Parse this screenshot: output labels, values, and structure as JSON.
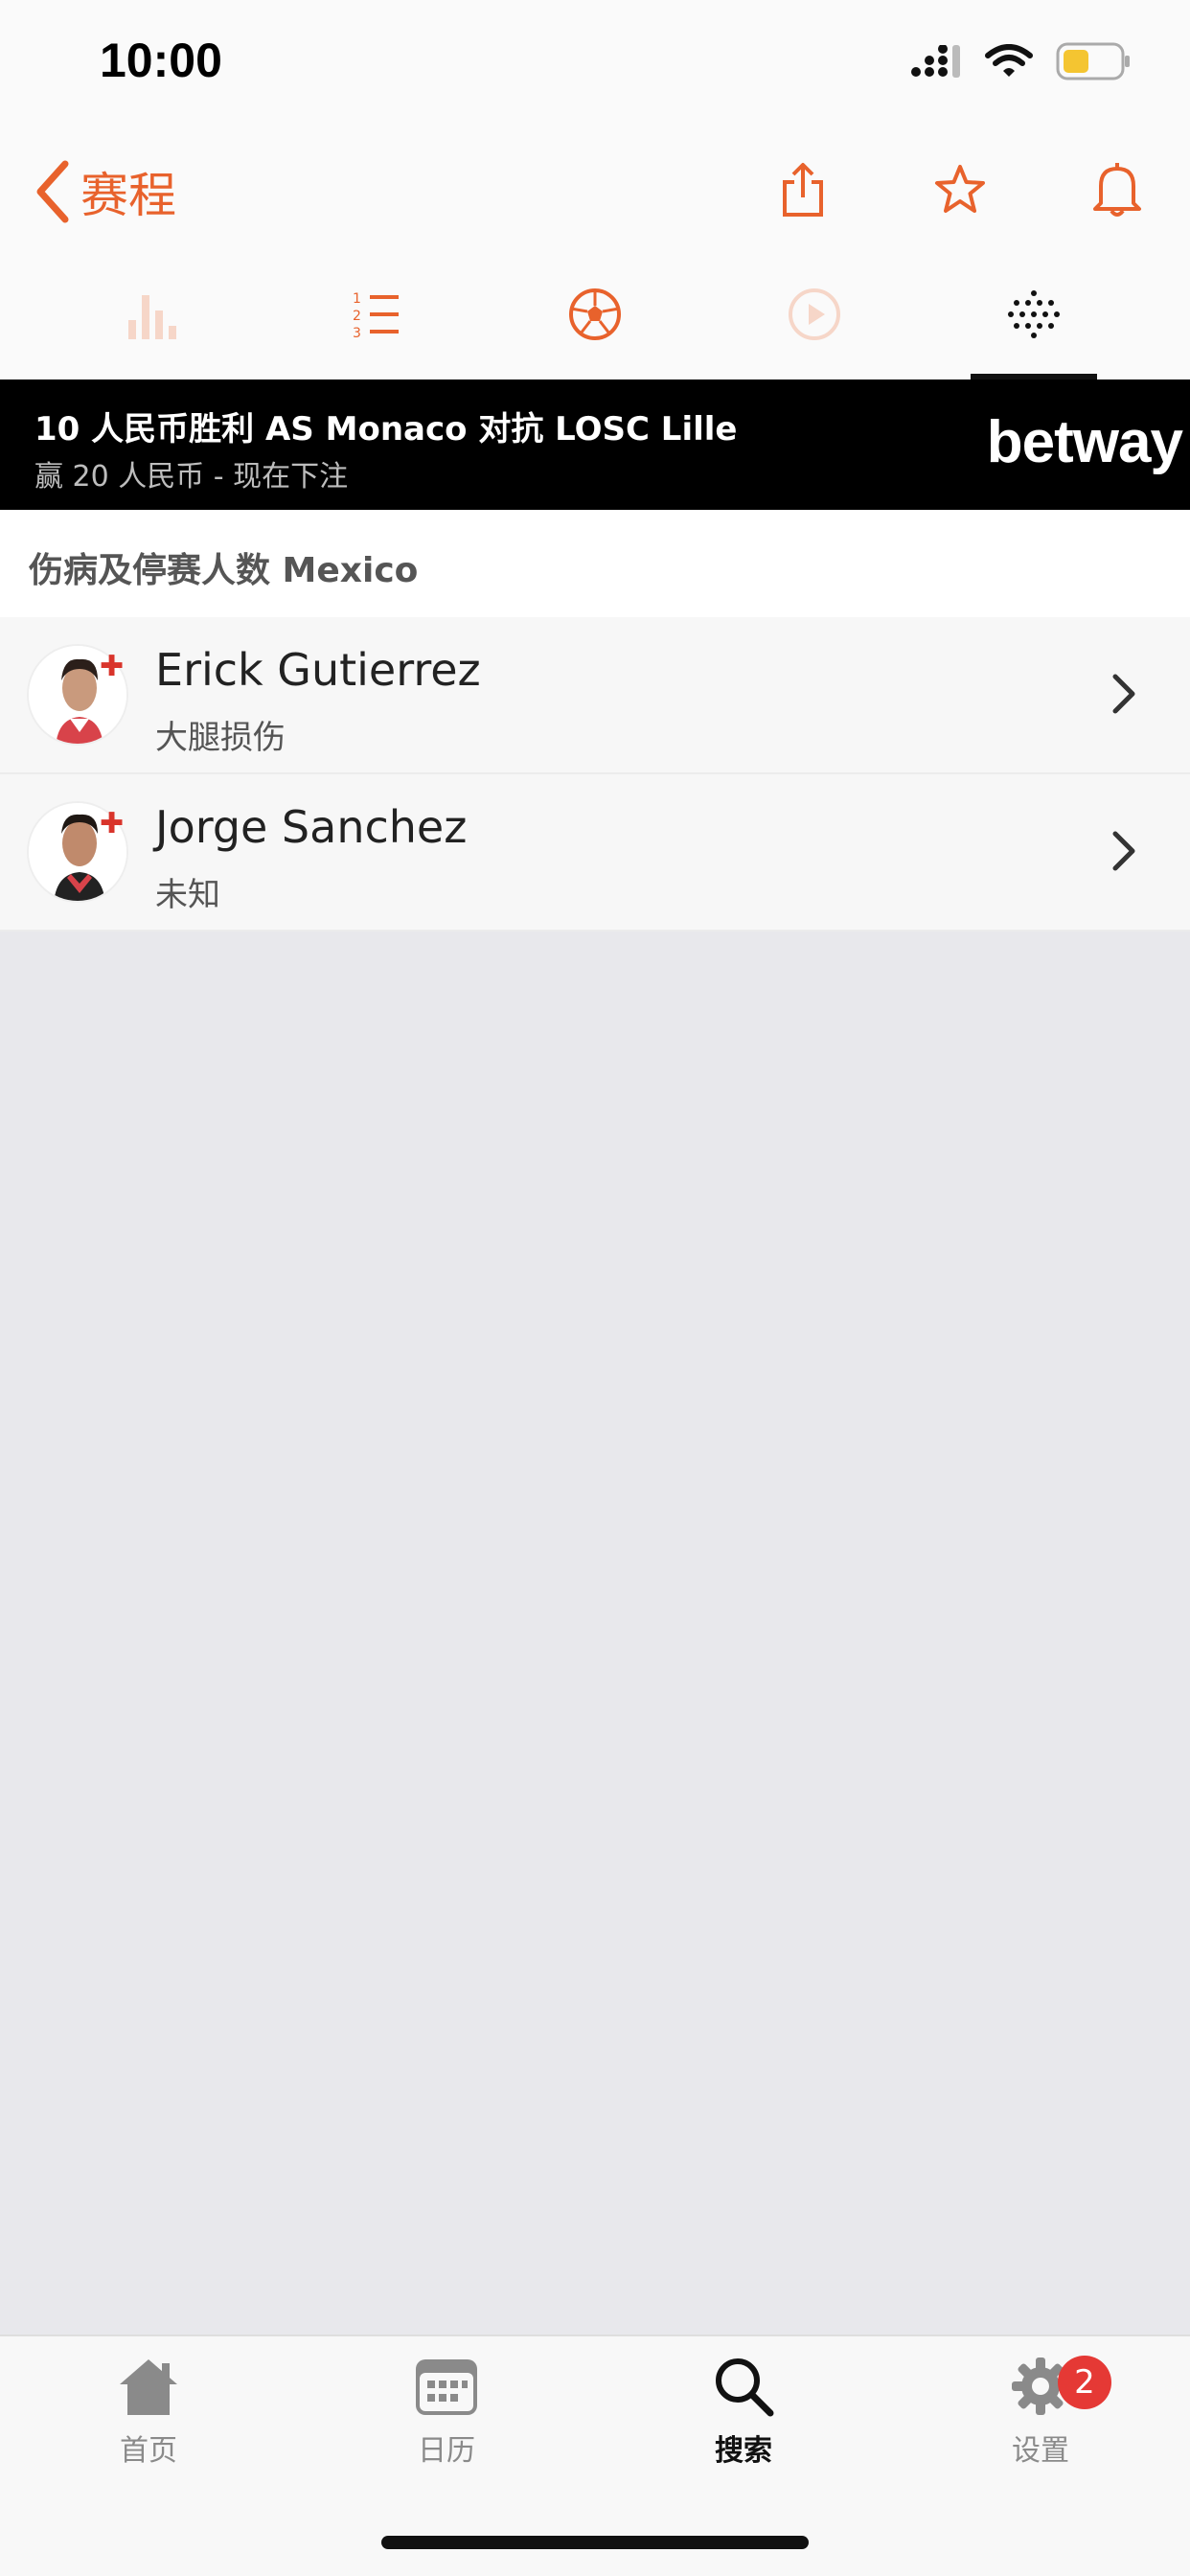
{
  "status_bar": {
    "time": "10:00"
  },
  "nav": {
    "back_label": "赛程",
    "accent_color": "#e8622c"
  },
  "tabs": [
    {
      "name": "stats-bar-chart-icon",
      "active": false
    },
    {
      "name": "standings-list-icon",
      "active": false
    },
    {
      "name": "soccer-ball-icon",
      "active": false
    },
    {
      "name": "play-video-icon",
      "active": false
    },
    {
      "name": "lineup-dots-icon",
      "active": true
    }
  ],
  "ad": {
    "title": "10 人民币胜利 AS Monaco 对抗 LOSC Lille",
    "subtitle": "赢 20 人民币 - 现在下注",
    "logo": "betway"
  },
  "section": {
    "title": "伤病及停赛人数 Mexico"
  },
  "players": [
    {
      "name": "Erick Gutierrez",
      "status": "大腿损伤"
    },
    {
      "name": "Jorge Sanchez",
      "status": "未知"
    }
  ],
  "bottom_tabs": [
    {
      "label": "首页",
      "icon": "home-icon"
    },
    {
      "label": "日历",
      "icon": "calendar-icon"
    },
    {
      "label": "搜索",
      "icon": "search-icon",
      "active": true
    },
    {
      "label": "设置",
      "icon": "gear-icon",
      "badge": "2"
    }
  ]
}
